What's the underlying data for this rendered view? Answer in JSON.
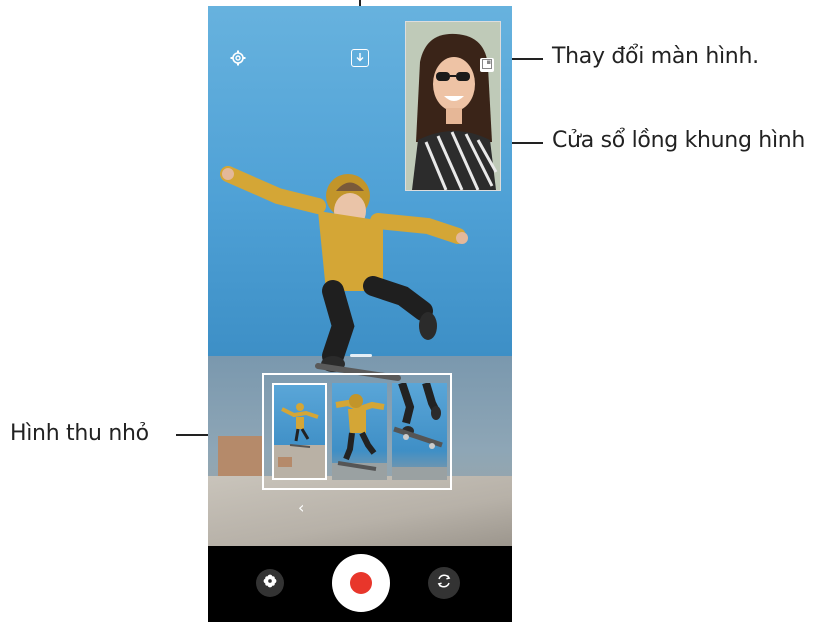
{
  "callouts": {
    "switch_screen": "Thay đổi màn hình.",
    "pip_window": "Cửa sổ lồng khung hình",
    "thumbnails": "Hình thu nhỏ"
  },
  "camera": {
    "settings_icon": "gear-icon",
    "download_icon": "download-icon",
    "switch_screen_icon": "swap-screen-icon",
    "back_chevron": "‹"
  },
  "controls": {
    "filter_icon": "flower-icon",
    "record_icon": "record-icon",
    "flip_icon": "flip-camera-icon"
  },
  "colors": {
    "record_red": "#e8362b",
    "jacket": "#d4a636"
  }
}
